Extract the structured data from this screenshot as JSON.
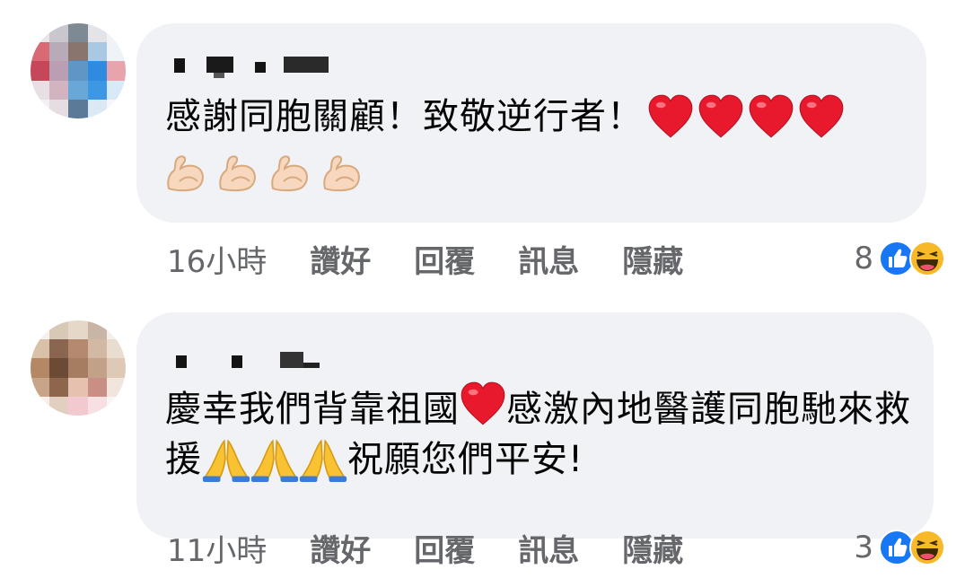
{
  "comments": [
    {
      "text": "感謝同胞關顧！致敬逆行者！",
      "emoji_trailing": [
        "red-heart",
        "red-heart",
        "red-heart",
        "red-heart"
      ],
      "emoji_line2": [
        "flexed-biceps",
        "flexed-biceps",
        "flexed-biceps",
        "flexed-biceps"
      ],
      "timestamp": "16小時",
      "actions": {
        "like": "讚好",
        "reply": "回覆",
        "message": "訊息",
        "hide": "隱藏"
      },
      "reaction_count": "8",
      "reactions": [
        "like",
        "haha"
      ]
    },
    {
      "text_part1": "慶幸我們背靠祖國",
      "text_part2": "感激內地醫護同胞馳來救援",
      "text_part3": "祝願您們平安!",
      "emoji_mid": [
        "red-heart"
      ],
      "emoji_prayer": [
        "folded-hands",
        "folded-hands",
        "folded-hands"
      ],
      "timestamp": "11小時",
      "actions": {
        "like": "讚好",
        "reply": "回覆",
        "message": "訊息",
        "hide": "隱藏"
      },
      "reaction_count": "3",
      "reactions": [
        "like",
        "haha"
      ]
    }
  ],
  "colors": {
    "bubble": "#f0f2f5",
    "meta_text": "#65676b",
    "body_text": "#050505",
    "like_blue": "#1877f2",
    "haha_yellow": "#f7b928",
    "heart_red": "#e8192c"
  }
}
